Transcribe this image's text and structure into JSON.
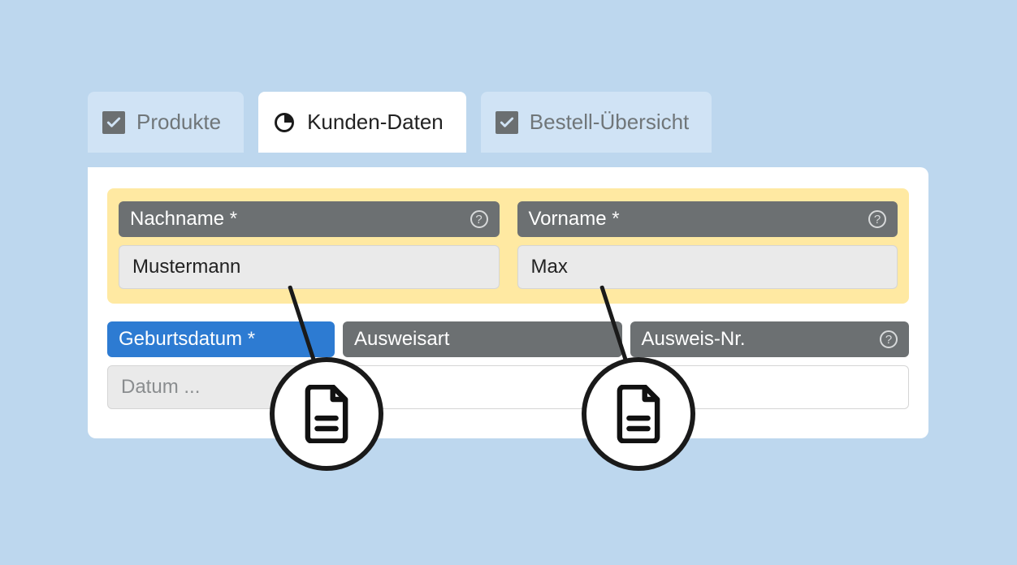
{
  "tabs": {
    "items": [
      {
        "label": "Produkte",
        "active": false
      },
      {
        "label": "Kunden-Daten",
        "active": true
      },
      {
        "label": "Bestell-Übersicht",
        "active": false
      }
    ]
  },
  "highlighted": {
    "lastname": {
      "label": "Nachname",
      "required_marker": "*",
      "value": "Mustermann"
    },
    "firstname": {
      "label": "Vorname",
      "required_marker": "*",
      "value": "Max"
    }
  },
  "row2": {
    "birthdate": {
      "label": "Geburtsdatum",
      "required_marker": "*",
      "placeholder": "Datum ..."
    },
    "idtype": {
      "label": "Ausweisart",
      "value": ""
    },
    "idnumber": {
      "label": "Ausweis-Nr.",
      "value": ""
    }
  },
  "help_glyph": "?",
  "colors": {
    "page_bg": "#bdd7ee",
    "tab_inactive_bg": "#d0e3f5",
    "tab_active_bg": "#ffffff",
    "label_grey": "#6c7072",
    "label_blue": "#2d7bd2",
    "highlight": "#ffe9a2"
  }
}
